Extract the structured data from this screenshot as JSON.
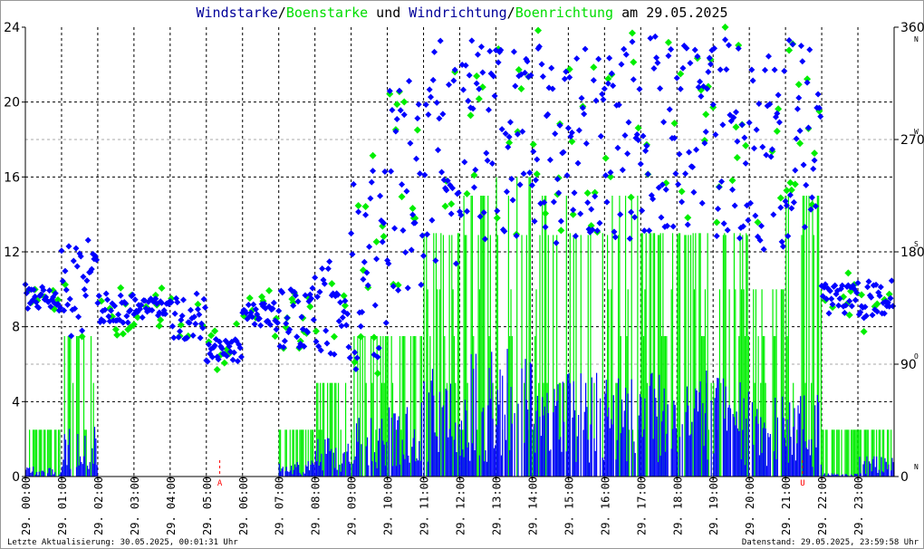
{
  "chart_data": {
    "type": "bar+scatter",
    "title": {
      "part1": "Windstarke",
      "sep1": "/",
      "part2": "Boenstarke",
      "mid": " und ",
      "part3": "Windrichtung",
      "sep2": "/",
      "part4": "Boenrichtung",
      "tail": " am 29.05.2025"
    },
    "colors": {
      "wind": "#0000ff",
      "gust": "#00ee00",
      "title_blue": "#000099",
      "marker": "#ff0000"
    },
    "ylim": [
      0,
      24
    ],
    "yticks": [
      "0",
      "4",
      "8",
      "12",
      "16",
      "20",
      "24"
    ],
    "y2lim": [
      0,
      360
    ],
    "y2ticks": [
      {
        "v": "0",
        "d": "N"
      },
      {
        "v": "90",
        "d": "O"
      },
      {
        "v": "180",
        "d": "S"
      },
      {
        "v": "270",
        "d": "W"
      },
      {
        "v": "360",
        "d": "N"
      }
    ],
    "xticks": [
      "29. 00:00",
      "29. 01:00",
      "29. 02:00",
      "29. 03:00",
      "29. 04:00",
      "29. 05:00",
      "29. 06:00",
      "29. 07:00",
      "29. 08:00",
      "29. 09:00",
      "29. 10:00",
      "29. 11:00",
      "29. 12:00",
      "29. 13:00",
      "29. 14:00",
      "29. 15:00",
      "29. 16:00",
      "29. 17:00",
      "29. 18:00",
      "29. 19:00",
      "29. 20:00",
      "29. 21:00",
      "29. 22:00",
      "29. 23:00"
    ],
    "markers": [
      {
        "label": "A",
        "hour": 5.37
      },
      {
        "label": "U",
        "hour": 21.47
      }
    ],
    "hourly": {
      "direction_mean_deg": [
        142,
        150,
        135,
        135,
        130,
        100,
        128,
        128,
        135,
        170,
        220,
        260,
        270,
        270,
        265,
        265,
        270,
        270,
        270,
        270,
        260,
        270,
        142,
        142
      ],
      "direction_spread_deg": [
        12,
        40,
        12,
        8,
        20,
        10,
        12,
        25,
        40,
        90,
        100,
        90,
        80,
        80,
        80,
        80,
        80,
        85,
        80,
        80,
        80,
        80,
        12,
        15
      ],
      "wind_speed_mean": [
        0.3,
        1.5,
        0,
        0,
        0,
        0,
        0,
        0.5,
        1.2,
        1.8,
        2.2,
        3.5,
        3.8,
        4.2,
        3.5,
        3.5,
        3.0,
        3.2,
        3.5,
        3.0,
        2.5,
        2.5,
        0.1,
        0.6
      ],
      "gust_max": [
        2.5,
        7.5,
        0,
        0,
        0,
        0,
        0,
        2.5,
        5,
        7.5,
        7.5,
        13,
        15,
        17,
        15,
        13,
        15,
        13,
        13,
        13,
        10,
        15,
        2.5,
        2.5
      ]
    }
  },
  "footer": {
    "left": "Letzte Aktualisierung: 30.05.2025, 00:01:31 Uhr",
    "right": "Datenstand: 29.05.2025, 23:59:58 Uhr"
  }
}
